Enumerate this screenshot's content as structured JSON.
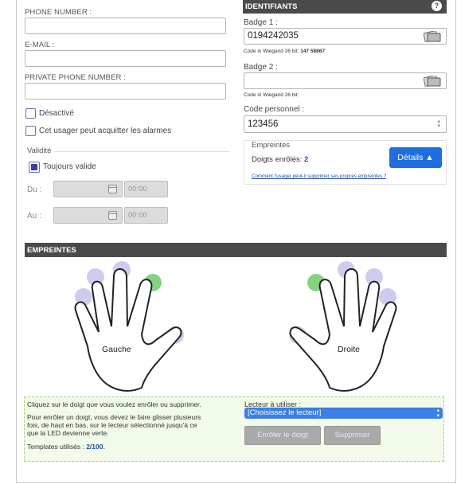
{
  "left": {
    "phone_label": "PHONE NUMBER :",
    "phone_value": "",
    "email_label": "E-MAIL :",
    "email_value": "",
    "private_phone_label": "PRIVATE PHONE NUMBER :",
    "private_phone_value": "",
    "disabled_label": "Désactivé",
    "acknowledge_label": "Cet usager peut acquitter les alarmes",
    "validity_label": "Validité",
    "always_valid_label": "Toujours valide",
    "from_label": "Du :",
    "from_time": "00:00",
    "to_label": "Au :",
    "to_time": "00:00"
  },
  "identifiers": {
    "header": "IDENTIFIANTS",
    "help_glyph": "?",
    "badge1_label": "Badge 1 :",
    "badge1_value": "0194242035",
    "wiegand1_prefix": "Code in Wiegand 26 bit:",
    "wiegand1_value": "147 58867",
    "badge2_label": "Badge 2 :",
    "badge2_value": "",
    "wiegand2_prefix": "Code in Wiegand 26 bit:",
    "personal_code_label": "Code personnel :",
    "personal_code_value": "123456",
    "fingerprints_label": "Empreintes",
    "enrolled_prefix": "Doigts enrôlés:",
    "enrolled_count": "2",
    "details_button": "Détails ▲",
    "delete_link": "Comment l'usager peut-il supprimer ses propres empreintes ?"
  },
  "fingerprints": {
    "header": "EMPREINTES",
    "left_hand": "Gauche",
    "right_hand": "Droite",
    "left_enrolled_finger": "index",
    "right_enrolled_finger": "index"
  },
  "info": {
    "line1": "Cliquez sur le doigt que vous voulez enrôler ou supprimer.",
    "line2a": "Pour enrôler un doigt, vous devez le faire glisser plusieurs",
    "line2b": "fois, de haut en bas, sur le lecteur sélectionné jusqu'à ce",
    "line2c": "que la LED devienne verte.",
    "templates_prefix": "Templates utilisés :",
    "templates_value": "2/100.",
    "reader_label": "Lecteur à utiliser :",
    "reader_selected": "[Choisissez le lecteur]",
    "enroll_button": "Enrôler le doigt",
    "delete_button": "Supprimer"
  },
  "colors": {
    "accent_blue": "#1f6ee0",
    "checkbox": "#3c3f9a",
    "enrolled_green": "#7ed07a",
    "finger_halo": "#c9c7ec",
    "header_dark": "#4a4a4a",
    "info_bg": "#f2fbe9"
  }
}
